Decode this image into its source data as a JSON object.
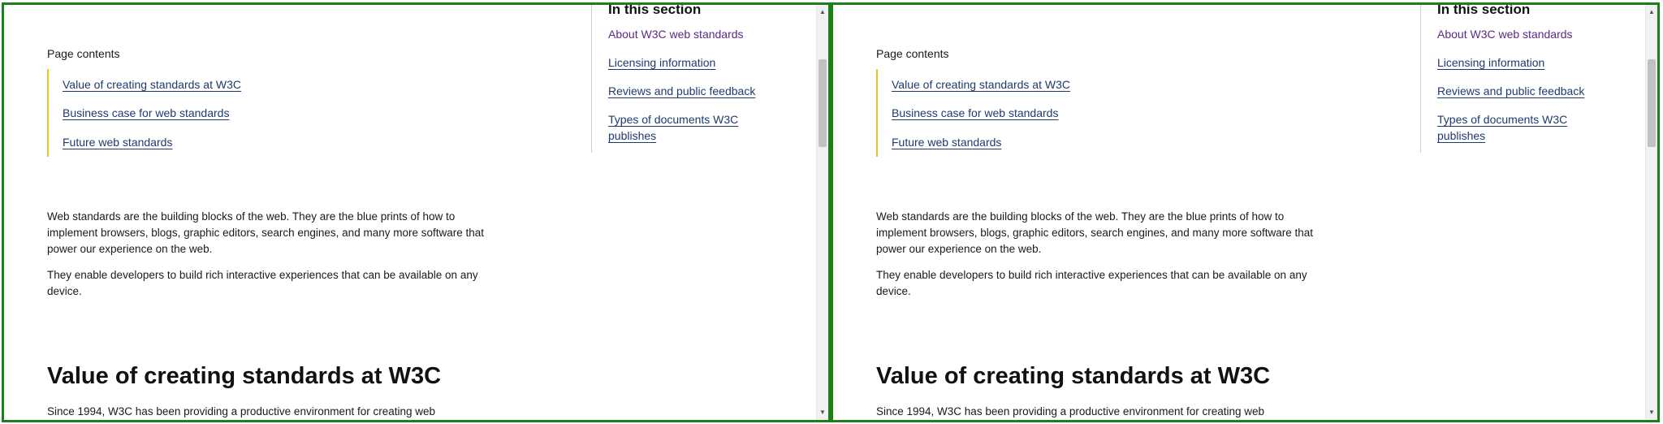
{
  "page": {
    "page_contents_label": "Page contents",
    "page_contents_links": [
      "Value of creating standards at W3C",
      "Business case for web standards",
      "Future web standards"
    ],
    "sidebar": {
      "title": "In this section",
      "links": [
        "About W3C web standards",
        "Licensing information",
        "Reviews and public feedback",
        "Types of documents W3C publishes"
      ]
    },
    "intro_paragraphs": [
      "Web standards are the building blocks of the web. They are the blue prints of how to implement browsers, blogs, graphic editors, search engines, and many more software that power our experience on the web.",
      "They enable developers to build rich interactive experiences that can be available on any device."
    ],
    "section_heading": "Value of creating standards at W3C",
    "section_text": "Since 1994, W3C has been providing a productive environment for creating web"
  },
  "scrollbar": {
    "up_arrow": "▲",
    "down_arrow": "▼"
  },
  "colors": {
    "frame_border": "#1b7f1b",
    "link": "#1f3a6e",
    "current_link": "#5b2a86",
    "contents_accent": "#f0c419"
  }
}
